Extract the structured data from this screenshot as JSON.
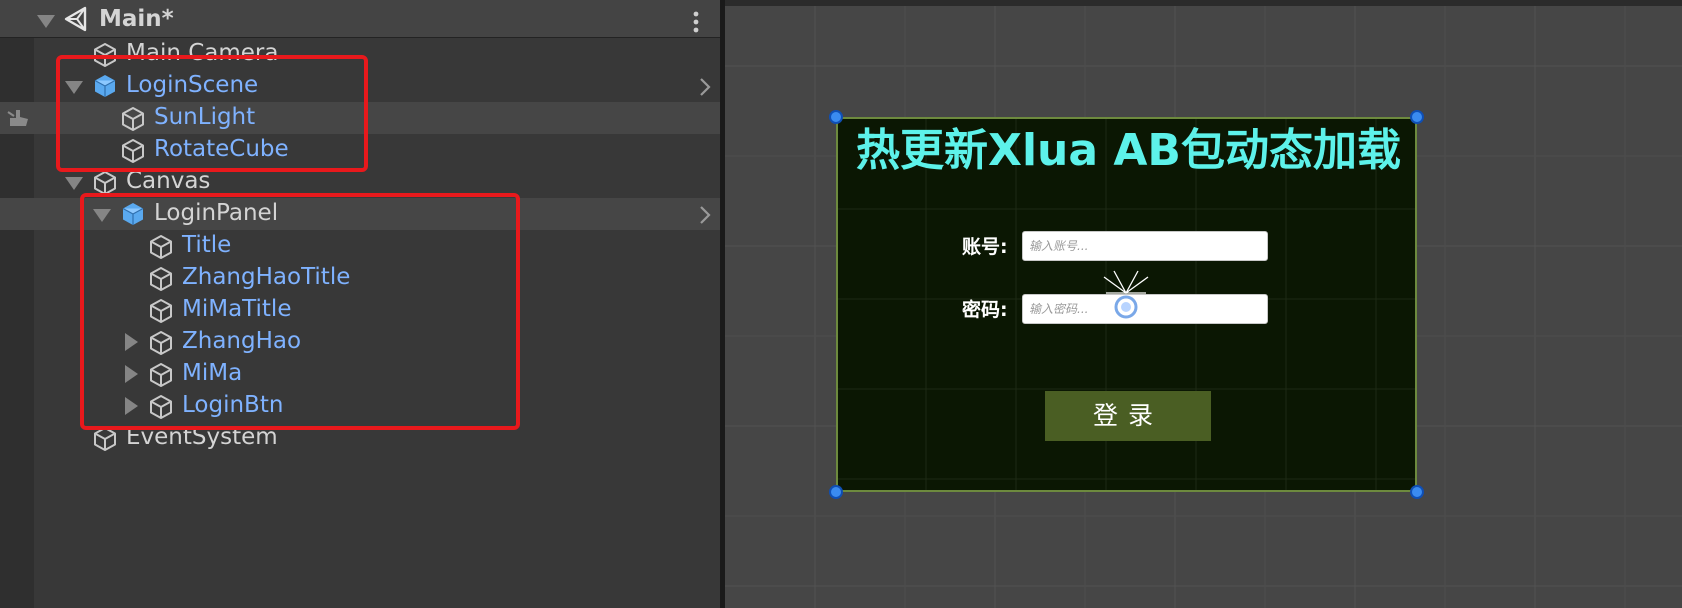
{
  "hierarchy": {
    "scene_title": "Main*",
    "items": [
      {
        "label": "Main Camera"
      },
      {
        "label": "LoginScene"
      },
      {
        "label": "SunLight"
      },
      {
        "label": "RotateCube"
      },
      {
        "label": "Canvas"
      },
      {
        "label": "LoginPanel"
      },
      {
        "label": "Title"
      },
      {
        "label": "ZhangHaoTitle"
      },
      {
        "label": "MiMaTitle"
      },
      {
        "label": "ZhangHao"
      },
      {
        "label": "MiMa"
      },
      {
        "label": "LoginBtn"
      },
      {
        "label": "EventSystem"
      }
    ]
  },
  "scene_view": {
    "title": "热更新Xlua AB包动态加载",
    "account_label": "账号:",
    "account_placeholder": "输入账号...",
    "password_label": "密码:",
    "password_placeholder": "输入密码...",
    "login_button": "登录"
  },
  "colors": {
    "prefab_blue": "#7fb2ff",
    "selection_red": "#e8191c",
    "title_cyan": "#5df2ea",
    "panel_bg": "#0b1703",
    "button_green": "#4a5e23"
  }
}
